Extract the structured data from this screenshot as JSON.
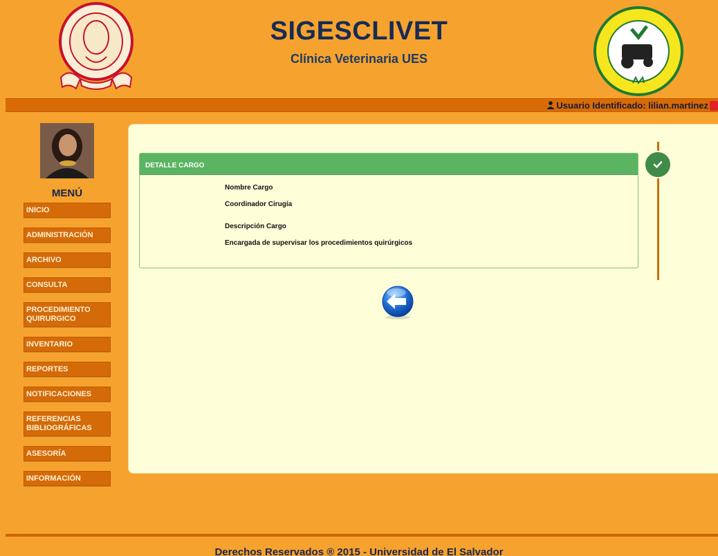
{
  "header": {
    "title": "SIGESCLIVET",
    "subtitle": "Clínica Veterinaria UES",
    "logo_left_text": "UNIVERSIDAD DE EL SALVADOR",
    "logo_left_bottom": "CENTRO AMERICA",
    "logo_right_text": "FACULTAD DE CIENCIAS AGRONOMICAS",
    "logo_right_words": [
      "PAN",
      "TIERRA",
      "LIBERTAD"
    ]
  },
  "userbar": {
    "label": "Usuario Identificado: lilian.martinez"
  },
  "sidebar": {
    "menu_title": "MENÚ",
    "items": [
      {
        "label": "INICIO"
      },
      {
        "label": "ADMINISTRACIÓN"
      },
      {
        "label": "ARCHIVO"
      },
      {
        "label": "CONSULTA"
      },
      {
        "label": "PROCEDIMIENTO QUIRURGICO"
      },
      {
        "label": "INVENTARIO"
      },
      {
        "label": "REPORTES"
      },
      {
        "label": "NOTIFICACIONES"
      },
      {
        "label": "REFERENCIAS BIBLIOGRÁFICAS"
      },
      {
        "label": "ASESORÍA"
      },
      {
        "label": "INFORMACIÓN"
      }
    ]
  },
  "detail": {
    "heading": "DETALLE CARGO",
    "fields": [
      {
        "label": "Nombre Cargo",
        "value": "Coordinador Cirugía"
      },
      {
        "label": "Descripción Cargo",
        "value": "Encargada de supervisar los procedimientos quirúrgicos"
      }
    ]
  },
  "icons": {
    "user": "user-icon",
    "power": "power-icon",
    "check": "check-icon",
    "back": "back-arrow-icon"
  },
  "colors": {
    "background": "#f5a32e",
    "menu_button": "#d56a08",
    "panel": "#fefed9",
    "detail_header": "#5bb462",
    "timeline_badge": "#3f8b47",
    "title": "#172b55"
  },
  "footer": {
    "text": "Derechos Reservados ® 2015 - Universidad de El Salvador"
  }
}
